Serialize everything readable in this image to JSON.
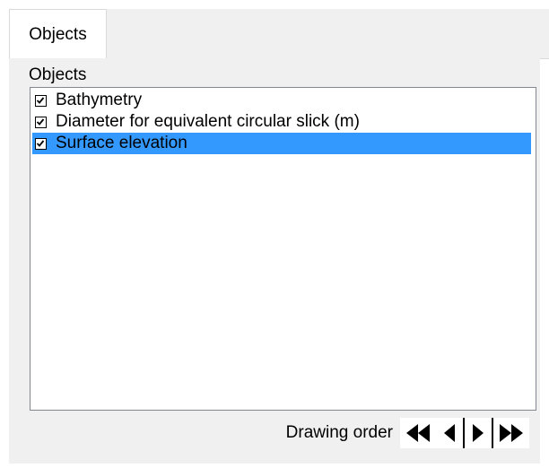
{
  "tabs": [
    {
      "label": "Objects",
      "active": true
    }
  ],
  "group": {
    "label": "Objects"
  },
  "list": {
    "items": [
      {
        "label": "Bathymetry",
        "checked": true,
        "selected": false
      },
      {
        "label": "Diameter for equivalent circular slick (m)",
        "checked": true,
        "selected": false
      },
      {
        "label": "Surface elevation",
        "checked": true,
        "selected": true
      }
    ]
  },
  "drawing_order": {
    "label": "Drawing order",
    "buttons": [
      {
        "name": "move-to-back",
        "icon": "double-left-arrow-icon"
      },
      {
        "name": "move-back",
        "icon": "left-arrow-icon"
      },
      {
        "name": "move-forward",
        "icon": "right-arrow-icon"
      },
      {
        "name": "move-to-front",
        "icon": "double-right-arrow-icon"
      }
    ]
  },
  "colors": {
    "selection": "#3399ff",
    "panel_bg": "#f0f0f0"
  }
}
